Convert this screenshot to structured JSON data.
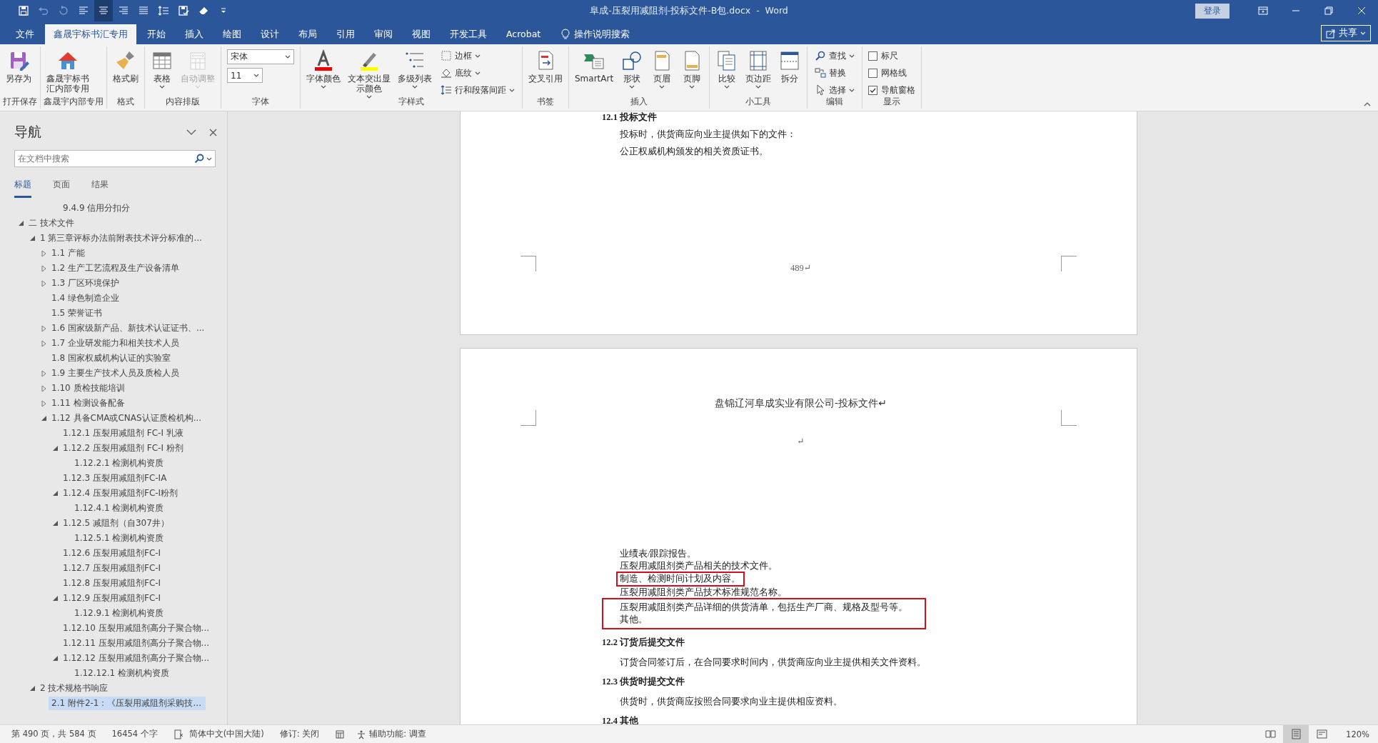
{
  "window": {
    "title": "阜成-压裂用减阻剂-投标文件-B包.docx  -  Word",
    "sign_in": "登录"
  },
  "quick_access": [
    {
      "kind": "save",
      "selected": false,
      "disabled": false
    },
    {
      "kind": "undo",
      "selected": false,
      "disabled": true
    },
    {
      "kind": "redo",
      "selected": false,
      "disabled": true
    },
    {
      "kind": "align_left",
      "selected": false,
      "disabled": false
    },
    {
      "kind": "align_center",
      "selected": true,
      "disabled": false
    },
    {
      "kind": "align_right",
      "selected": false,
      "disabled": false
    },
    {
      "kind": "justify",
      "selected": false,
      "disabled": false
    },
    {
      "kind": "line_spacing",
      "selected": false,
      "disabled": false
    },
    {
      "kind": "save_check",
      "selected": false,
      "disabled": false
    },
    {
      "kind": "eraser",
      "selected": false,
      "disabled": false
    },
    {
      "kind": "customize",
      "selected": false,
      "disabled": false
    }
  ],
  "menu_tabs": [
    {
      "label": "文件",
      "selected": false
    },
    {
      "label": "鑫晟宇标书汇专用",
      "selected": true
    },
    {
      "label": "开始",
      "selected": false
    },
    {
      "label": "插入",
      "selected": false
    },
    {
      "label": "绘图",
      "selected": false
    },
    {
      "label": "设计",
      "selected": false
    },
    {
      "label": "布局",
      "selected": false
    },
    {
      "label": "引用",
      "selected": false
    },
    {
      "label": "审阅",
      "selected": false
    },
    {
      "label": "视图",
      "selected": false
    },
    {
      "label": "开发工具",
      "selected": false
    },
    {
      "label": "Acrobat",
      "selected": false
    }
  ],
  "tell_me": "操作说明搜索",
  "share": "共享",
  "ribbon": [
    {
      "label": "打开保存",
      "controls": [
        {
          "kind": "large",
          "label": "另存为",
          "dropdown": false,
          "disabled": false
        }
      ]
    },
    {
      "label": "鑫晟宇内部专用",
      "controls": [
        {
          "kind": "large",
          "label": "鑫晟宇标书汇内部专用",
          "dropdown": false,
          "disabled": false
        }
      ]
    },
    {
      "label": "格式",
      "controls": [
        {
          "kind": "large",
          "label": "格式刷",
          "dropdown": false,
          "disabled": false
        }
      ]
    },
    {
      "label": "内容排版",
      "controls": [
        {
          "kind": "large",
          "label": "表格",
          "dropdown": true,
          "disabled": false
        },
        {
          "kind": "large",
          "label": "自动调整",
          "dropdown": true,
          "disabled": true
        }
      ]
    },
    {
      "label": "字体",
      "controls": [
        {
          "kind": "font_name",
          "value": "宋体"
        },
        {
          "kind": "font_size",
          "value": "11"
        }
      ]
    },
    {
      "label": "字样式",
      "controls": [
        {
          "kind": "large",
          "label": "字体颜色",
          "dropdown": true,
          "disabled": false
        },
        {
          "kind": "large",
          "label": "文本突出显示颜色",
          "dropdown": true,
          "disabled": false
        },
        {
          "kind": "large",
          "label": "多级列表",
          "dropdown": true,
          "disabled": false
        },
        {
          "kind": "small",
          "label": "边框",
          "dropdown": true,
          "disabled": false
        },
        {
          "kind": "small",
          "label": "底纹",
          "dropdown": true,
          "disabled": false
        },
        {
          "kind": "small",
          "label": "行和段落间距",
          "dropdown": true,
          "disabled": false
        }
      ]
    },
    {
      "label": "书签",
      "controls": [
        {
          "kind": "large",
          "label": "交叉引用",
          "dropdown": false,
          "disabled": false
        }
      ]
    },
    {
      "label": "插入",
      "controls": [
        {
          "kind": "large",
          "label": "SmartArt",
          "dropdown": false,
          "disabled": false
        },
        {
          "kind": "large",
          "label": "形状",
          "dropdown": true,
          "disabled": false
        },
        {
          "kind": "large",
          "label": "页眉",
          "dropdown": true,
          "disabled": false
        },
        {
          "kind": "large",
          "label": "页脚",
          "dropdown": true,
          "disabled": false
        }
      ]
    },
    {
      "label": "小工具",
      "controls": [
        {
          "kind": "large",
          "label": "比较",
          "dropdown": true,
          "disabled": false
        },
        {
          "kind": "large",
          "label": "页边距",
          "dropdown": true,
          "disabled": false
        },
        {
          "kind": "large",
          "label": "拆分",
          "dropdown": false,
          "disabled": false
        }
      ]
    },
    {
      "label": "编辑",
      "controls": [
        {
          "kind": "small",
          "label": "查找",
          "dropdown": true,
          "disabled": false
        },
        {
          "kind": "small",
          "label": "替换",
          "dropdown": false,
          "disabled": false
        },
        {
          "kind": "small",
          "label": "选择",
          "dropdown": true,
          "disabled": false
        }
      ]
    },
    {
      "label": "显示",
      "controls": [
        {
          "kind": "check",
          "label": "标尺",
          "checked": false
        },
        {
          "kind": "check",
          "label": "网格线",
          "checked": false
        },
        {
          "kind": "check",
          "label": "导航窗格",
          "checked": true
        }
      ]
    }
  ],
  "navigation": {
    "title": "导航",
    "search": {
      "placeholder": "在文档中搜索"
    },
    "tabs": [
      {
        "label": "标题",
        "selected": true
      },
      {
        "label": "页面",
        "selected": false
      },
      {
        "label": "结果",
        "selected": false
      }
    ],
    "scrolled_item": "9.4.9 信用分扣分",
    "tree": [
      {
        "label": "二 技术文件",
        "expanded": true,
        "selected": false,
        "children": [
          {
            "label": "1 第三章评标办法前附表技术评分标准的...",
            "expanded": true,
            "selected": false,
            "children": [
              {
                "label": "1.1 产能",
                "expanded": false,
                "selected": false
              },
              {
                "label": "1.2 生产工艺流程及生产设备清单",
                "expanded": false,
                "selected": false
              },
              {
                "label": "1.3 厂区环境保护",
                "expanded": false,
                "selected": false
              },
              {
                "label": "1.4 绿色制造企业",
                "selected": false
              },
              {
                "label": "1.5 荣誉证书",
                "selected": false
              },
              {
                "label": "1.6 国家级新产品、新技术认证证书、...",
                "expanded": false,
                "selected": false
              },
              {
                "label": "1.7 企业研发能力和相关技术人员",
                "expanded": false,
                "selected": false
              },
              {
                "label": "1.8 国家权威机构认证的实验室",
                "selected": false
              },
              {
                "label": "1.9 主要生产技术人员及质检人员",
                "expanded": false,
                "selected": false
              },
              {
                "label": "1.10 质检技能培训",
                "expanded": false,
                "selected": false
              },
              {
                "label": "1.11 检测设备配备",
                "expanded": false,
                "selected": false
              },
              {
                "label": "1.12 具备CMA或CNAS认证质检机构...",
                "expanded": true,
                "selected": false,
                "children": [
                  {
                    "label": "1.12.1 压裂用减阻剂  FC-Ⅰ 乳液",
                    "selected": false
                  },
                  {
                    "label": "1.12.2 压裂用减阻剂  FC-Ⅰ 粉剂",
                    "expanded": true,
                    "selected": false,
                    "children": [
                      {
                        "label": "1.12.2.1 检测机构资质",
                        "selected": false
                      }
                    ]
                  },
                  {
                    "label": "1.12.3 压裂用减阻剂FC-IA",
                    "selected": false
                  },
                  {
                    "label": "1.12.4 压裂用减阻剂FC-I粉剂",
                    "expanded": true,
                    "selected": false,
                    "children": [
                      {
                        "label": "1.12.4.1 检测机构资质",
                        "selected": false
                      }
                    ]
                  },
                  {
                    "label": "1.12.5 减阻剂（自307井）",
                    "expanded": true,
                    "selected": false,
                    "children": [
                      {
                        "label": "1.12.5.1 检测机构资质",
                        "selected": false
                      }
                    ]
                  },
                  {
                    "label": "1.12.6 压裂用减阻剂FC-I",
                    "selected": false
                  },
                  {
                    "label": "1.12.7 压裂用减阻剂FC-I",
                    "selected": false
                  },
                  {
                    "label": "1.12.8 压裂用减阻剂FC-I",
                    "selected": false
                  },
                  {
                    "label": "1.12.9 压裂用减阻剂FC-I",
                    "expanded": true,
                    "selected": false,
                    "children": [
                      {
                        "label": "1.12.9.1 检测机构资质",
                        "selected": false
                      }
                    ]
                  },
                  {
                    "label": "1.12.10 压裂用减阻剂高分子聚合物...",
                    "selected": false
                  },
                  {
                    "label": "1.12.11 压裂用减阻剂高分子聚合物...",
                    "selected": false
                  },
                  {
                    "label": "1.12.12 压裂用减阻剂高分子聚合物...",
                    "expanded": true,
                    "selected": false,
                    "children": [
                      {
                        "label": "1.12.12.1 检测机构资质",
                        "selected": false
                      }
                    ]
                  }
                ]
              }
            ]
          },
          {
            "label": "2 技术规格书响应",
            "expanded": true,
            "selected": false,
            "children": [
              {
                "label": "2.1 附件2-1：《压裂用减阻剂采购技...",
                "selected": true
              }
            ]
          }
        ]
      }
    ]
  },
  "document": {
    "pages": [
      {
        "blocks": [
          {
            "kind": "heading",
            "text": "12.1 投标文件"
          },
          {
            "kind": "paragraph",
            "text": "投标时，供货商应向业主提供如下的文件："
          },
          {
            "kind": "paragraph",
            "text": "公正权威机构颁发的相关资质证书。"
          }
        ],
        "page_number": "489↵"
      },
      {
        "header": "盘锦辽河阜成实业有限公司-投标文件↵",
        "blocks": [
          {
            "kind": "mark",
            "text": "↵"
          },
          {
            "kind": "line",
            "text": "业绩表/跟踪报告。"
          },
          {
            "kind": "line",
            "text": "压裂用减阻剂类产品相关的技术文件。"
          },
          {
            "kind": "framed",
            "lines": [
              "制造、检测时间计划及内容。"
            ]
          },
          {
            "kind": "line",
            "text": "压裂用减阻剂类产品技术标准规范名称。"
          },
          {
            "kind": "framed",
            "lines": [
              "压裂用减阻剂类产品详细的供货清单，包括生产厂商、规格及型号等。",
              "其他。"
            ]
          },
          {
            "kind": "heading",
            "text": "12.2 订货后提交文件"
          },
          {
            "kind": "paragraph",
            "text": "订货合同签订后，在合同要求时间内，供货商应向业主提供相关文件资料。"
          },
          {
            "kind": "heading",
            "text": "12.3 供货时提交文件"
          },
          {
            "kind": "paragraph",
            "text": "供货时，供货商应按照合同要求向业主提供相应资料。"
          },
          {
            "kind": "heading",
            "text": "12.4 其他"
          }
        ]
      }
    ]
  },
  "status_bar": {
    "page": "第 490 页，共 584 页",
    "words": "16454 个字",
    "language": "简体中文(中国大陆)",
    "track_changes": "修订: 关闭",
    "accessibility": "辅助功能: 调查",
    "views": [
      {
        "kind": "read",
        "selected": false
      },
      {
        "kind": "print",
        "selected": true
      },
      {
        "kind": "web",
        "selected": false
      }
    ],
    "zoom": "120%"
  }
}
